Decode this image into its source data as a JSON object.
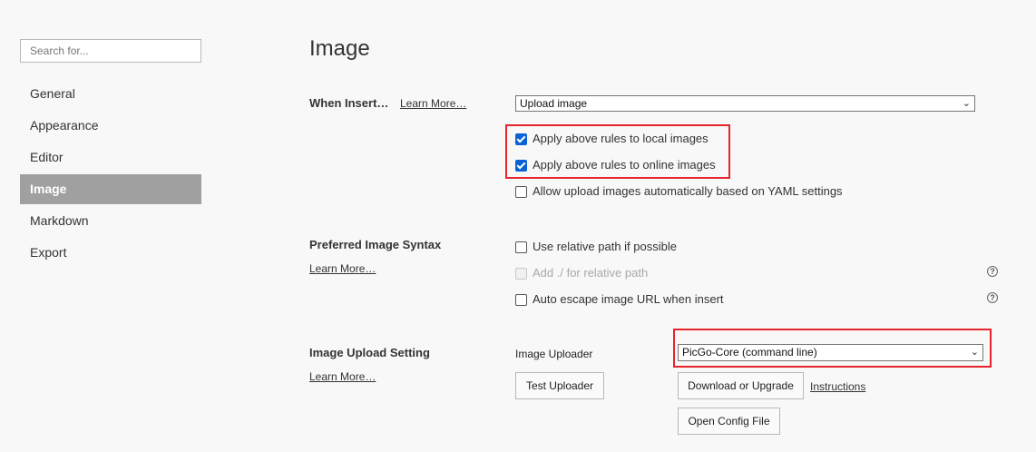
{
  "sidebar": {
    "search_placeholder": "Search for...",
    "items": [
      {
        "label": "General"
      },
      {
        "label": "Appearance"
      },
      {
        "label": "Editor"
      },
      {
        "label": "Image",
        "active": true
      },
      {
        "label": "Markdown"
      },
      {
        "label": "Export"
      }
    ]
  },
  "main": {
    "title": "Image",
    "when_insert": {
      "title": "When Insert…",
      "learn_more": "Learn More…",
      "select_value": "Upload image",
      "options": [
        {
          "label": "Apply above rules to local images",
          "checked": true
        },
        {
          "label": "Apply above rules to online images",
          "checked": true
        },
        {
          "label": "Allow upload images automatically based on YAML settings",
          "checked": false
        }
      ]
    },
    "syntax": {
      "title": "Preferred Image Syntax",
      "learn_more": "Learn More…",
      "options": [
        {
          "label": "Use relative path if possible",
          "checked": false
        },
        {
          "label": "Add ./ for relative path",
          "checked": false,
          "disabled": true
        },
        {
          "label": "Auto escape image URL when insert",
          "checked": false
        }
      ]
    },
    "upload": {
      "title": "Image Upload Setting",
      "learn_more": "Learn More…",
      "uploader_label": "Image Uploader",
      "uploader_value": "PicGo-Core (command line)",
      "test_button": "Test Uploader",
      "download_button": "Download or Upgrade",
      "instructions_link": "Instructions",
      "open_config_button": "Open Config File"
    },
    "help_icon": "?",
    "chevron_icon": "⌄"
  },
  "colors": {
    "highlight": "#e5242c",
    "active_nav": "#a0a0a0",
    "checkbox": "#0a63d6"
  }
}
